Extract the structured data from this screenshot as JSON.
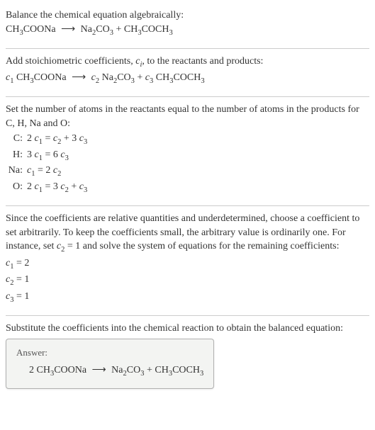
{
  "step1": {
    "instruction": "Balance the chemical equation algebraically:",
    "lhs_compound": "CH",
    "lhs_sub1": "3",
    "lhs_tail": "COONa",
    "arrow": "⟶",
    "rhs1_a": "Na",
    "rhs1_s1": "2",
    "rhs1_b": "CO",
    "rhs1_s2": "3",
    "plus": " + ",
    "rhs2_a": "CH",
    "rhs2_s1": "3",
    "rhs2_b": "COCH",
    "rhs2_s2": "3"
  },
  "step2": {
    "instruction_a": "Add stoichiometric coefficients, ",
    "ci": "c",
    "ci_sub": "i",
    "instruction_b": ", to the reactants and products:",
    "c1": "c",
    "c1s": "1",
    "sp": " ",
    "lhs_compound": "CH",
    "lhs_sub1": "3",
    "lhs_tail": "COONa",
    "arrow": "⟶",
    "c2": "c",
    "c2s": "2",
    "rhs1_a": "Na",
    "rhs1_s1": "2",
    "rhs1_b": "CO",
    "rhs1_s2": "3",
    "plus": " + ",
    "c3": "c",
    "c3s": "3",
    "rhs2_a": "CH",
    "rhs2_s1": "3",
    "rhs2_b": "COCH",
    "rhs2_s2": "3"
  },
  "step3": {
    "instruction": "Set the number of atoms in the reactants equal to the number of atoms in the products for C, H, Na and O:",
    "rows": {
      "r0l": "C:",
      "r0_a": "2 ",
      "r0_c1": "c",
      "r0_c1s": "1",
      "r0_eq": " = ",
      "r0_c2": "c",
      "r0_c2s": "2",
      "r0_p": " + 3 ",
      "r0_c3": "c",
      "r0_c3s": "3",
      "r1l": "H:",
      "r1_a": "3 ",
      "r1_c1": "c",
      "r1_c1s": "1",
      "r1_eq": " = 6 ",
      "r1_c3": "c",
      "r1_c3s": "3",
      "r2l": "Na:",
      "r2_c1": "c",
      "r2_c1s": "1",
      "r2_eq": " = 2 ",
      "r2_c2": "c",
      "r2_c2s": "2",
      "r3l": "O:",
      "r3_a": "2 ",
      "r3_c1": "c",
      "r3_c1s": "1",
      "r3_eq": " = 3 ",
      "r3_c2": "c",
      "r3_c2s": "2",
      "r3_p": " + ",
      "r3_c3": "c",
      "r3_c3s": "3"
    }
  },
  "step4": {
    "text_a": "Since the coefficients are relative quantities and underdetermined, choose a coefficient to set arbitrarily. To keep the coefficients small, the arbitrary value is ordinarily one. For instance, set ",
    "c2": "c",
    "c2s": "2",
    "text_b": " = 1 and solve the system of equations for the remaining coefficients:",
    "l1_c": "c",
    "l1_s": "1",
    "l1_v": " = 2",
    "l2_c": "c",
    "l2_s": "2",
    "l2_v": " = 1",
    "l3_c": "c",
    "l3_s": "3",
    "l3_v": " = 1"
  },
  "step5": {
    "instruction": "Substitute the coefficients into the chemical reaction to obtain the balanced equation:",
    "answer_label": "Answer:",
    "coef1": "2 ",
    "lhs_compound": "CH",
    "lhs_sub1": "3",
    "lhs_tail": "COONa",
    "arrow": "⟶",
    "rhs1_a": "Na",
    "rhs1_s1": "2",
    "rhs1_b": "CO",
    "rhs1_s2": "3",
    "plus": " + ",
    "rhs2_a": "CH",
    "rhs2_s1": "3",
    "rhs2_b": "COCH",
    "rhs2_s2": "3"
  }
}
